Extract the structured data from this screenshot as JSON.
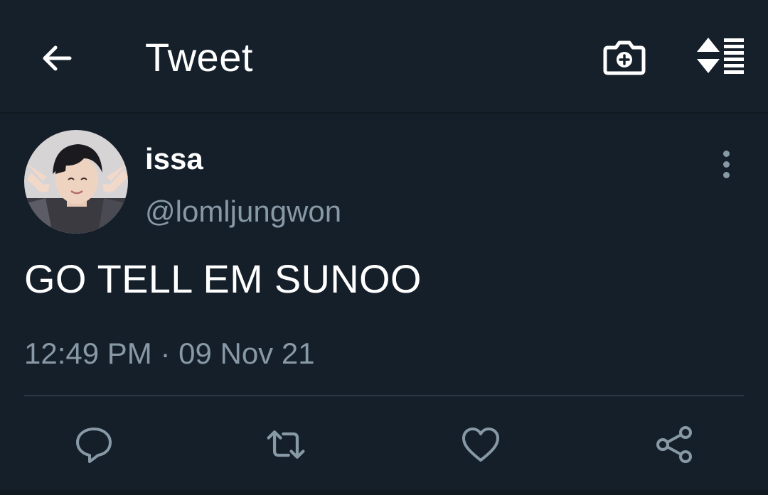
{
  "header": {
    "title": "Tweet",
    "back_icon": "arrow-left-icon",
    "camera_icon": "camera-plus-icon",
    "sort_icon": "sort-list-icon"
  },
  "tweet": {
    "display_name": "issa",
    "handle": "@lomljungwon",
    "text": "GO TELL EM SUNOO",
    "timestamp": "12:49 PM · 09 Nov 21",
    "more_icon": "more-vertical-icon"
  },
  "actions": [
    {
      "icon": "reply-icon"
    },
    {
      "icon": "retweet-icon"
    },
    {
      "icon": "like-icon"
    },
    {
      "icon": "share-icon"
    }
  ],
  "colors": {
    "background": "#151f2a",
    "primary_text": "#ffffff",
    "secondary_text": "#8899a6",
    "divider": "#2a3744"
  }
}
